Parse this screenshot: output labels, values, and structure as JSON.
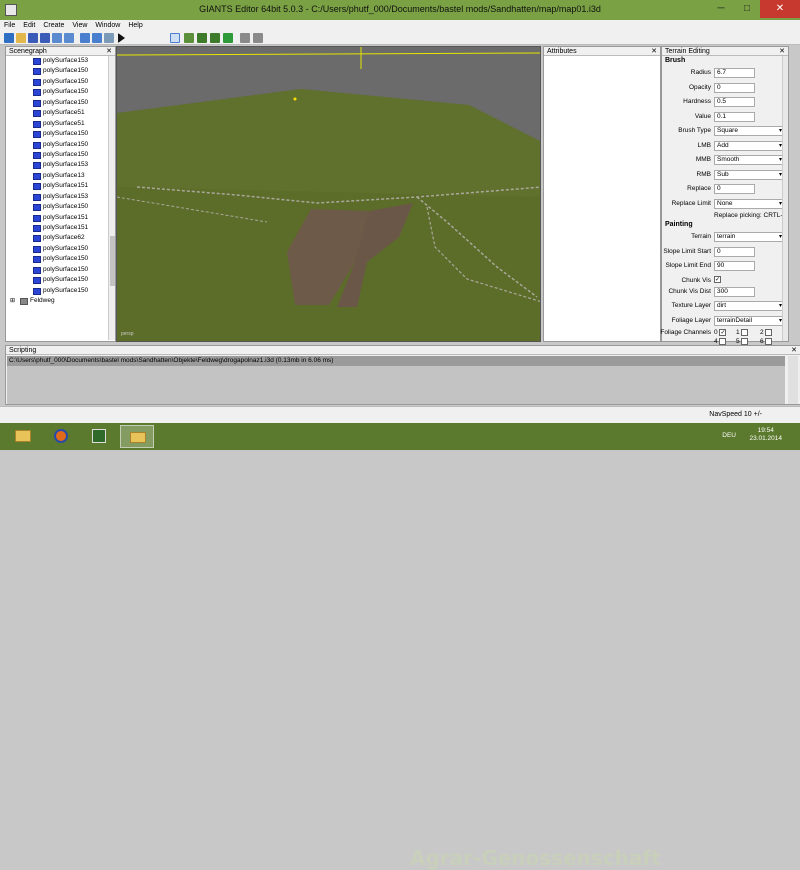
{
  "window": {
    "title": "GIANTS Editor 64bit 5.0.3 - C:/Users/phutf_000/Documents/bastel mods/Sandhatten/map/map01.i3d",
    "controls": {
      "minimize": "─",
      "maximize": "□",
      "close": "✕"
    }
  },
  "menu": [
    "File",
    "Edit",
    "Create",
    "View",
    "Window",
    "Help"
  ],
  "toolbar": {
    "icons": [
      "new-icon",
      "open-icon",
      "save-icon",
      "save-all-icon",
      "import-icon",
      "export-icon",
      "undo-icon",
      "redo-icon",
      "refresh-icon",
      "play-icon",
      "select-icon",
      "terrain-sculpt-icon",
      "terrain-paint-icon",
      "foliage-paint-icon",
      "grass-icon",
      "snap-icon",
      "settings-icon"
    ]
  },
  "scenegraph": {
    "title": "Scenegraph",
    "close": "✕",
    "items": [
      "polySurface153",
      "polySurface150",
      "polySurface150",
      "polySurface150",
      "polySurface150",
      "polySurface51",
      "polySurface51",
      "polySurface150",
      "polySurface150",
      "polySurface150",
      "polySurface153",
      "polySurface13",
      "polySurface151",
      "polySurface153",
      "polySurface150",
      "polySurface151",
      "polySurface151",
      "polySurface62",
      "polySurface150",
      "polySurface150",
      "polySurface150",
      "polySurface150",
      "polySurface150"
    ],
    "group": "Feldweg"
  },
  "viewport": {
    "camera": "persp"
  },
  "attributes": {
    "title": "Attributes",
    "close": "✕"
  },
  "terrain_editing": {
    "title": "Terrain Editing",
    "close": "✕",
    "brush_header": "Brush",
    "radius_label": "Radius",
    "radius": "6.7",
    "opacity_label": "Opacity",
    "opacity": "0",
    "hardness_label": "Hardness",
    "hardness": "0.5",
    "value_label": "Value",
    "value": "0.1",
    "brush_type_label": "Brush Type",
    "brush_type": "Square",
    "lmb_label": "LMB",
    "lmb": "Add",
    "mmb_label": "MMB",
    "mmb": "Smooth",
    "rmb_label": "RMB",
    "rmb": "Sub",
    "replace_label": "Replace",
    "replace": "0",
    "replace_limit_label": "Replace Limit",
    "replace_limit": "None",
    "replace_picking": "Replace picking: CRTL-R",
    "painting_header": "Painting",
    "terrain_label": "Terrain",
    "terrain": "terrain",
    "slope_start_label": "Slope Limit Start",
    "slope_start": "0",
    "slope_end_label": "Slope Limit End",
    "slope_end": "90",
    "chunk_vis_label": "Chunk Vis",
    "chunk_vis_check": "✓",
    "chunk_vis_dist_label": "Chunk Vis Dist",
    "chunk_vis_dist": "300",
    "texture_layer_label": "Texture Layer",
    "texture_layer": "dirt",
    "foliage_layer_label": "Foliage Layer",
    "foliage_layer": "terrainDetail",
    "foliage_channels_label": "Foliage Channels",
    "channels": [
      "0",
      "1",
      "2",
      "4",
      "5",
      "6"
    ],
    "channel0_check": "✓",
    "dropdown_arrow": "▾"
  },
  "scripting": {
    "title": "Scripting",
    "close": "✕",
    "log": "C:\\Users\\phutf_000\\Documents\\bastel mods\\Sandhatten\\Objekte\\Feldweg\\drogapolnaz1.i3d (0.13mb in 6.06 ms)"
  },
  "status": {
    "nav_speed": "NavSpeed 10 +/-"
  },
  "taskbar": {
    "watermark": "Agrar-Genossenschaft",
    "lang": "DEU",
    "time": "19:54",
    "date": "23.01.2014",
    "apps": [
      "file-explorer-icon",
      "firefox-icon",
      "giants-editor-icon",
      "folder-icon"
    ]
  },
  "colors": {
    "titlebar": "#7aa244",
    "terrain_grass": "#5e6e2a",
    "dirt": "#6e5a48",
    "taskbar": "#5b7a2e"
  }
}
